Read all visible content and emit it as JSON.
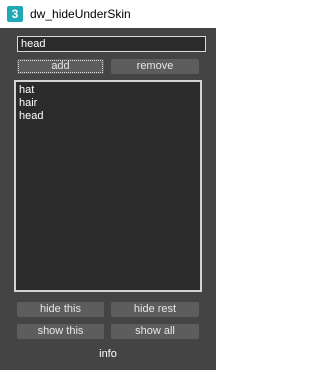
{
  "window": {
    "title": "dw_hideUnderSkin",
    "app_icon_glyph": "3",
    "icon": "3ds-max-app-icon"
  },
  "name_input": {
    "value": "head"
  },
  "buttons": {
    "add": "add",
    "remove": "remove",
    "hide_this": "hide this",
    "hide_rest": "hide rest",
    "show_this": "show this",
    "show_all": "show all"
  },
  "list": {
    "items": [
      "hat",
      "hair",
      "head"
    ]
  },
  "footer": {
    "info_label": "info"
  },
  "colors": {
    "panel_bg": "#444444",
    "field_bg": "#2b2b2b",
    "button_bg": "#5d5d5d",
    "app_icon": "#1fa9b6"
  }
}
